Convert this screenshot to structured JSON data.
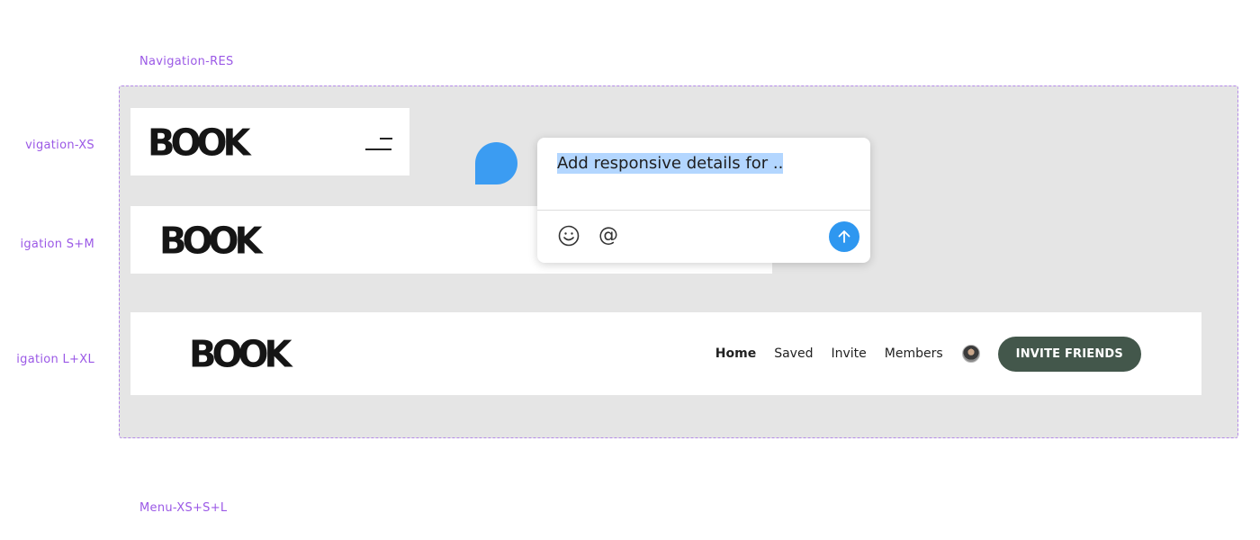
{
  "labels": {
    "res": "Navigation-RES",
    "xs": "vigation-XS",
    "sm": "igation S+M",
    "lxl": "igation L+XL",
    "menu": "Menu-XS+S+L"
  },
  "logo": {
    "text": "BOOK"
  },
  "nav": {
    "links": [
      "Home",
      "Saved",
      "Invite",
      "Members"
    ],
    "active": "Home",
    "cta_label": "INVITE FRIENDS"
  },
  "comment": {
    "text": "Add responsive details for .."
  },
  "colors": {
    "accent_purple": "#9b59e6",
    "cta_green": "#43574b",
    "comment_blue": "#3b9cf2",
    "selection": "#b3d6ff"
  },
  "icons": {
    "menu": "hamburger-icon",
    "emoji": "smiley-icon",
    "mention": "at-icon",
    "send": "arrow-up-icon",
    "pin": "comment-pin-icon"
  }
}
